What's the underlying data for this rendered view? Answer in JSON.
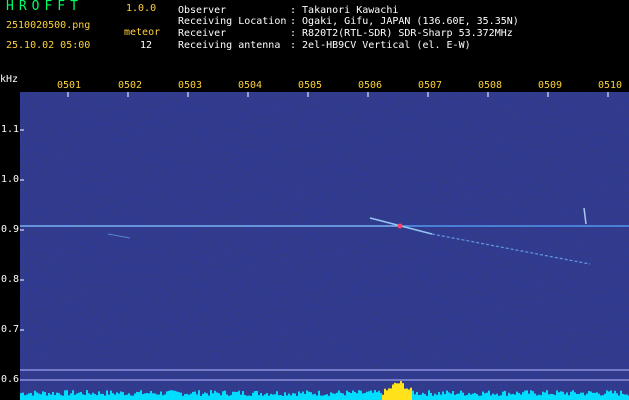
{
  "app": {
    "title": "HROFFT",
    "version": "1.0.0"
  },
  "file": {
    "name": "2510020500.png",
    "datetime": "25.10.02 05:00",
    "mode": "meteor",
    "count": "12"
  },
  "info": [
    {
      "key": "Observer",
      "value": ": Takanori Kawachi"
    },
    {
      "key": "Receiving Location",
      "value": ": Ogaki, Gifu, JAPAN (136.60E, 35.35N)"
    },
    {
      "key": "Receiver",
      "value": ": R820T2(RTL-SDR) SDR-Sharp 53.372MHz"
    },
    {
      "key": "Receiving antenna",
      "value": ": 2el-HB9CV Vertical (el. E-W)"
    }
  ],
  "axis": {
    "unit": "kHz",
    "time_ticks": [
      "0501",
      "0502",
      "0503",
      "0504",
      "0505",
      "0506",
      "0507",
      "0508",
      "0509",
      "0510"
    ],
    "freq_ticks": [
      "1.1",
      "1.0",
      "0.9",
      "0.8",
      "0.7",
      "0.6"
    ]
  },
  "colors": {
    "accent_title": "#00ff66",
    "label": "#ffd23a",
    "spectrum": "#00ddff",
    "background": "#000033"
  }
}
